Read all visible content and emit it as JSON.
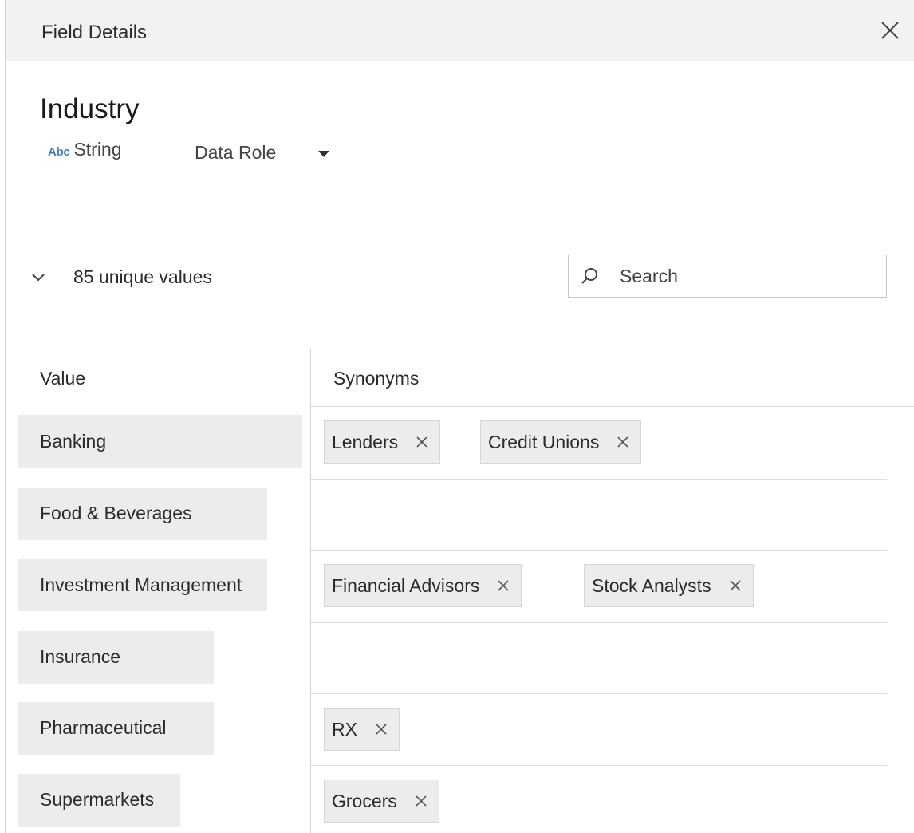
{
  "panel": {
    "title": "Field Details",
    "close_label": "close"
  },
  "field": {
    "name": "Industry",
    "type_icon_text": "Abc",
    "type_label": "String",
    "data_role_label": "Data Role"
  },
  "values_section": {
    "count_label": "85 unique values",
    "search_placeholder": "Search",
    "search_value": ""
  },
  "table": {
    "columns": [
      "Value",
      "Synonyms"
    ],
    "rows": [
      {
        "value": "Banking",
        "synonyms": [
          "Lenders",
          "Credit Unions"
        ]
      },
      {
        "value": "Food & Beverages",
        "synonyms": []
      },
      {
        "value": "Investment Management",
        "synonyms": [
          "Financial Advisors",
          "Stock Analysts"
        ]
      },
      {
        "value": "Insurance",
        "synonyms": []
      },
      {
        "value": "Pharmaceutical",
        "synonyms": [
          "RX"
        ]
      },
      {
        "value": "Supermarkets",
        "synonyms": [
          "Grocers"
        ]
      }
    ]
  },
  "icons": {
    "close": "close-icon",
    "data_role_dropdown": "caret-down-icon",
    "expand": "chevron-down-icon",
    "search": "search-icon",
    "remove_synonym": "remove-x-icon"
  },
  "colors": {
    "header_bg": "#f2f2f2",
    "value_cell_bg": "#ececec",
    "chip_bg": "#ececec",
    "type_icon": "#3a7fbf",
    "divider": "#d4d4d4"
  }
}
